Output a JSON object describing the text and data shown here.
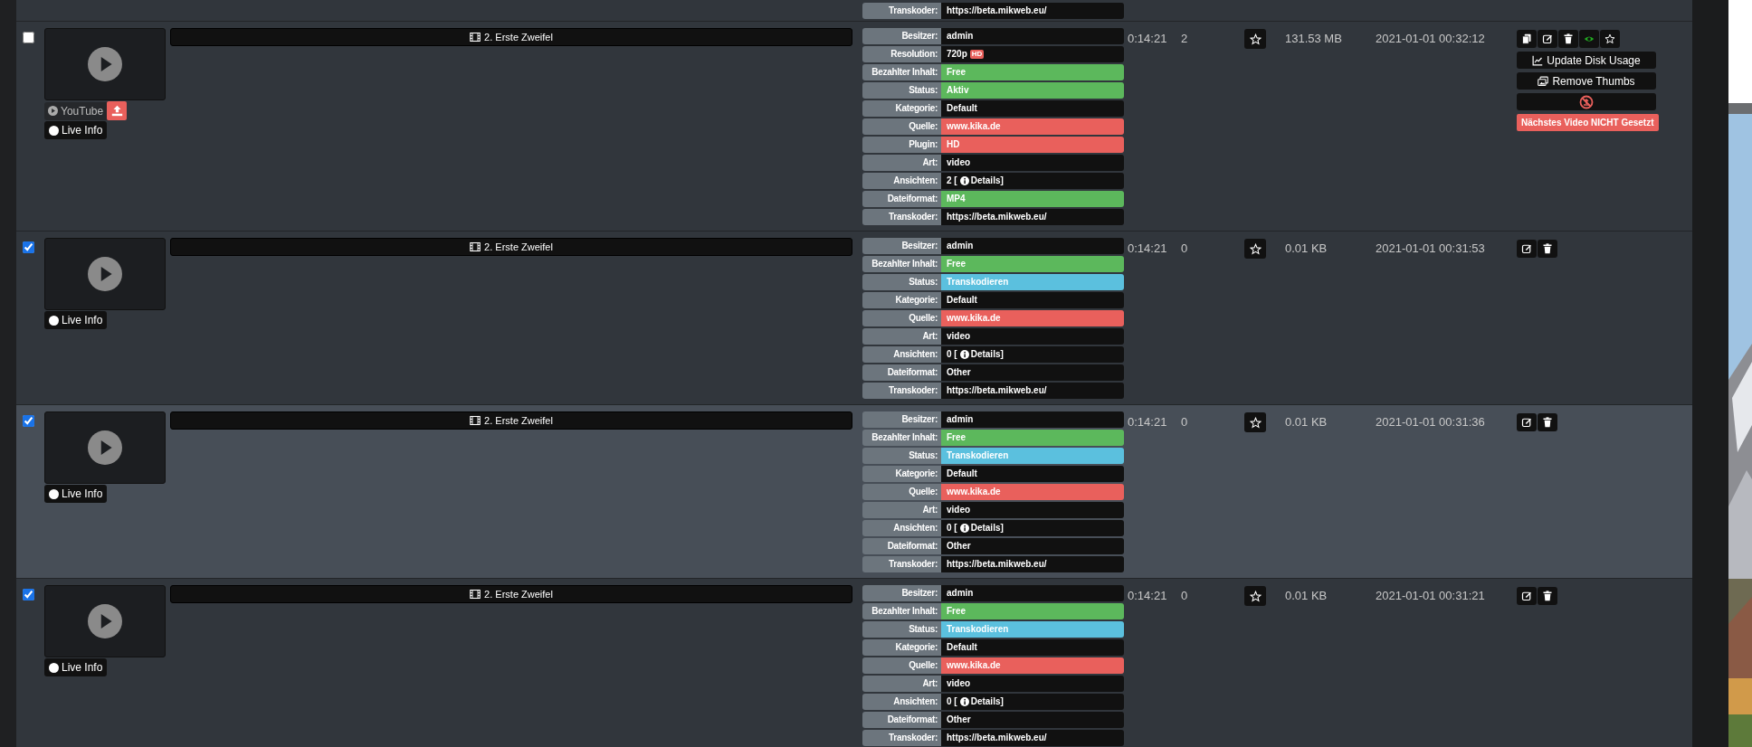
{
  "rows": [
    {
      "meta": [
        {
          "label": "Transkoder:",
          "value": "https://beta.mikweb.eu/"
        }
      ]
    },
    {
      "checked": false,
      "highlighted": false,
      "title": "2. Erste Zweifel",
      "youtube": "YouTube",
      "upload": true,
      "live_info": "Live Info",
      "meta": [
        {
          "label": "Besitzer:",
          "value": "admin"
        },
        {
          "label": "Resolution:",
          "value": "720p",
          "badge": "HD"
        },
        {
          "label": "Bezahlter Inhalt:",
          "value": "Free",
          "color": "#5cb85c"
        },
        {
          "label": "Status:",
          "value": "Aktiv",
          "color": "#5cb85c"
        },
        {
          "label": "Kategorie:",
          "value": "Default"
        },
        {
          "label": "Quelle:",
          "value": "www.kika.de",
          "color": "#e9605c"
        },
        {
          "label": "Plugin:",
          "value": "HD",
          "color": "#e9605c"
        },
        {
          "label": "Art:",
          "value": "video"
        },
        {
          "label": "Ansichten:",
          "value": "2 [",
          "link": "Details]"
        },
        {
          "label": "Dateiformat:",
          "value": "MP4",
          "color": "#5cb85c"
        },
        {
          "label": "Transkoder:",
          "value": "https://beta.mikweb.eu/"
        }
      ],
      "duration": "0:14:21",
      "views": "2",
      "starred": false,
      "size": "131.53 MB",
      "date": "2021-01-01 00:32:12",
      "action_icons": [
        {
          "kind": "copy"
        },
        {
          "kind": "edit"
        },
        {
          "kind": "trash"
        },
        {
          "kind": "eye"
        },
        {
          "kind": "star"
        }
      ],
      "action_buttons": [
        {
          "kind": "chart",
          "label": "Update Disk Usage"
        },
        {
          "kind": "images",
          "label": "Remove Thumbs"
        },
        {
          "kind": "no-upload"
        }
      ],
      "notice": "Nächstes Video NICHT Gesetzt"
    },
    {
      "checked": true,
      "highlighted": false,
      "title": "2. Erste Zweifel",
      "live_info": "Live Info",
      "meta": [
        {
          "label": "Besitzer:",
          "value": "admin"
        },
        {
          "label": "Bezahlter Inhalt:",
          "value": "Free",
          "color": "#5cb85c"
        },
        {
          "label": "Status:",
          "value": "Transkodieren",
          "color": "#5bc0de"
        },
        {
          "label": "Kategorie:",
          "value": "Default"
        },
        {
          "label": "Quelle:",
          "value": "www.kika.de",
          "color": "#e9605c"
        },
        {
          "label": "Art:",
          "value": "video"
        },
        {
          "label": "Ansichten:",
          "value": "0 [",
          "link": "Details]"
        },
        {
          "label": "Dateiformat:",
          "value": "Other"
        },
        {
          "label": "Transkoder:",
          "value": "https://beta.mikweb.eu/"
        }
      ],
      "duration": "0:14:21",
      "views": "0",
      "starred": false,
      "size": "0.01 KB",
      "date": "2021-01-01 00:31:53",
      "action_icons": [
        {
          "kind": "edit"
        },
        {
          "kind": "trash"
        }
      ]
    },
    {
      "checked": true,
      "highlighted": true,
      "title": "2. Erste Zweifel",
      "live_info": "Live Info",
      "meta": [
        {
          "label": "Besitzer:",
          "value": "admin"
        },
        {
          "label": "Bezahlter Inhalt:",
          "value": "Free",
          "color": "#5cb85c"
        },
        {
          "label": "Status:",
          "value": "Transkodieren",
          "color": "#5bc0de"
        },
        {
          "label": "Kategorie:",
          "value": "Default"
        },
        {
          "label": "Quelle:",
          "value": "www.kika.de",
          "color": "#e9605c"
        },
        {
          "label": "Art:",
          "value": "video"
        },
        {
          "label": "Ansichten:",
          "value": "0 [",
          "link": "Details]"
        },
        {
          "label": "Dateiformat:",
          "value": "Other"
        },
        {
          "label": "Transkoder:",
          "value": "https://beta.mikweb.eu/"
        }
      ],
      "duration": "0:14:21",
      "views": "0",
      "starred": false,
      "size": "0.01 KB",
      "date": "2021-01-01 00:31:36",
      "action_icons": [
        {
          "kind": "edit"
        },
        {
          "kind": "trash"
        }
      ]
    },
    {
      "checked": true,
      "highlighted": false,
      "title": "2. Erste Zweifel",
      "live_info": "Live Info",
      "meta": [
        {
          "label": "Besitzer:",
          "value": "admin"
        },
        {
          "label": "Bezahlter Inhalt:",
          "value": "Free",
          "color": "#5cb85c"
        },
        {
          "label": "Status:",
          "value": "Transkodieren",
          "color": "#5bc0de"
        },
        {
          "label": "Kategorie:",
          "value": "Default"
        },
        {
          "label": "Quelle:",
          "value": "www.kika.de",
          "color": "#e9605c"
        },
        {
          "label": "Art:",
          "value": "video"
        },
        {
          "label": "Ansichten:",
          "value": "0 [",
          "link": "Details]"
        },
        {
          "label": "Dateiformat:",
          "value": "Other"
        },
        {
          "label": "Transkoder:",
          "value": "https://beta.mikweb.eu/"
        }
      ],
      "duration": "0:14:21",
      "views": "0",
      "starred": false,
      "size": "0.01 KB",
      "date": "2021-01-01 00:31:21",
      "action_icons": [
        {
          "kind": "edit"
        },
        {
          "kind": "trash"
        }
      ]
    }
  ]
}
